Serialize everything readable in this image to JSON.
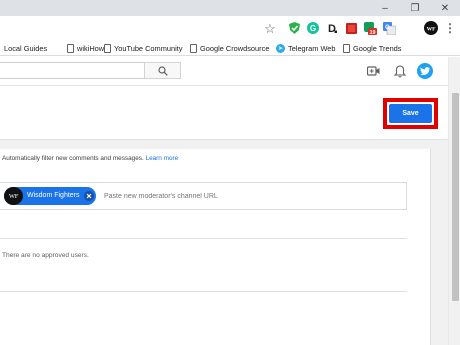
{
  "window": {
    "minimize_glyph": "–",
    "restore_glyph": "❐",
    "close_glyph": "✕"
  },
  "toolbar": {
    "icons": [
      "star-icon",
      "shield-extension-icon",
      "grammarly-icon",
      "dashlane-icon",
      "red-square-extension-icon",
      "badge-extension-icon",
      "translate-icon",
      "profile-avatar",
      "menu-icon"
    ],
    "badge_count": "19",
    "star_glyph": "☆",
    "menu_glyph": "⋮",
    "profile_initials": "WF"
  },
  "bookmarks": [
    {
      "label": "Local Guides",
      "icon": "none"
    },
    {
      "label": "wikiHow",
      "icon": "page-icon"
    },
    {
      "label": "YouTube Community",
      "icon": "page-icon"
    },
    {
      "label": "Google Crowdsource",
      "icon": "page-icon"
    },
    {
      "label": "Telegram Web",
      "icon": "telegram-icon"
    },
    {
      "label": "Google Trends",
      "icon": "page-icon"
    }
  ],
  "header": {
    "search_placeholder": "",
    "icons": [
      "search-icon",
      "create-video-icon",
      "notifications-bell-icon",
      "twitter-avatar"
    ]
  },
  "save_bar": {
    "save_label": "Save"
  },
  "moderation": {
    "filter_prefix": "Automatically filter new ",
    "filter_bold": "comments and messages.",
    "learn_more": "Learn more",
    "moderator_chip": {
      "avatar_text": "WF",
      "name": "Wisdom Fighters"
    },
    "moderator_placeholder": "Paste new moderator's channel URL",
    "approved_empty": "There are no approved users."
  },
  "colors": {
    "accent": "#1a73e8",
    "highlight_box": "#e00000",
    "twitter": "#1da1f2"
  }
}
